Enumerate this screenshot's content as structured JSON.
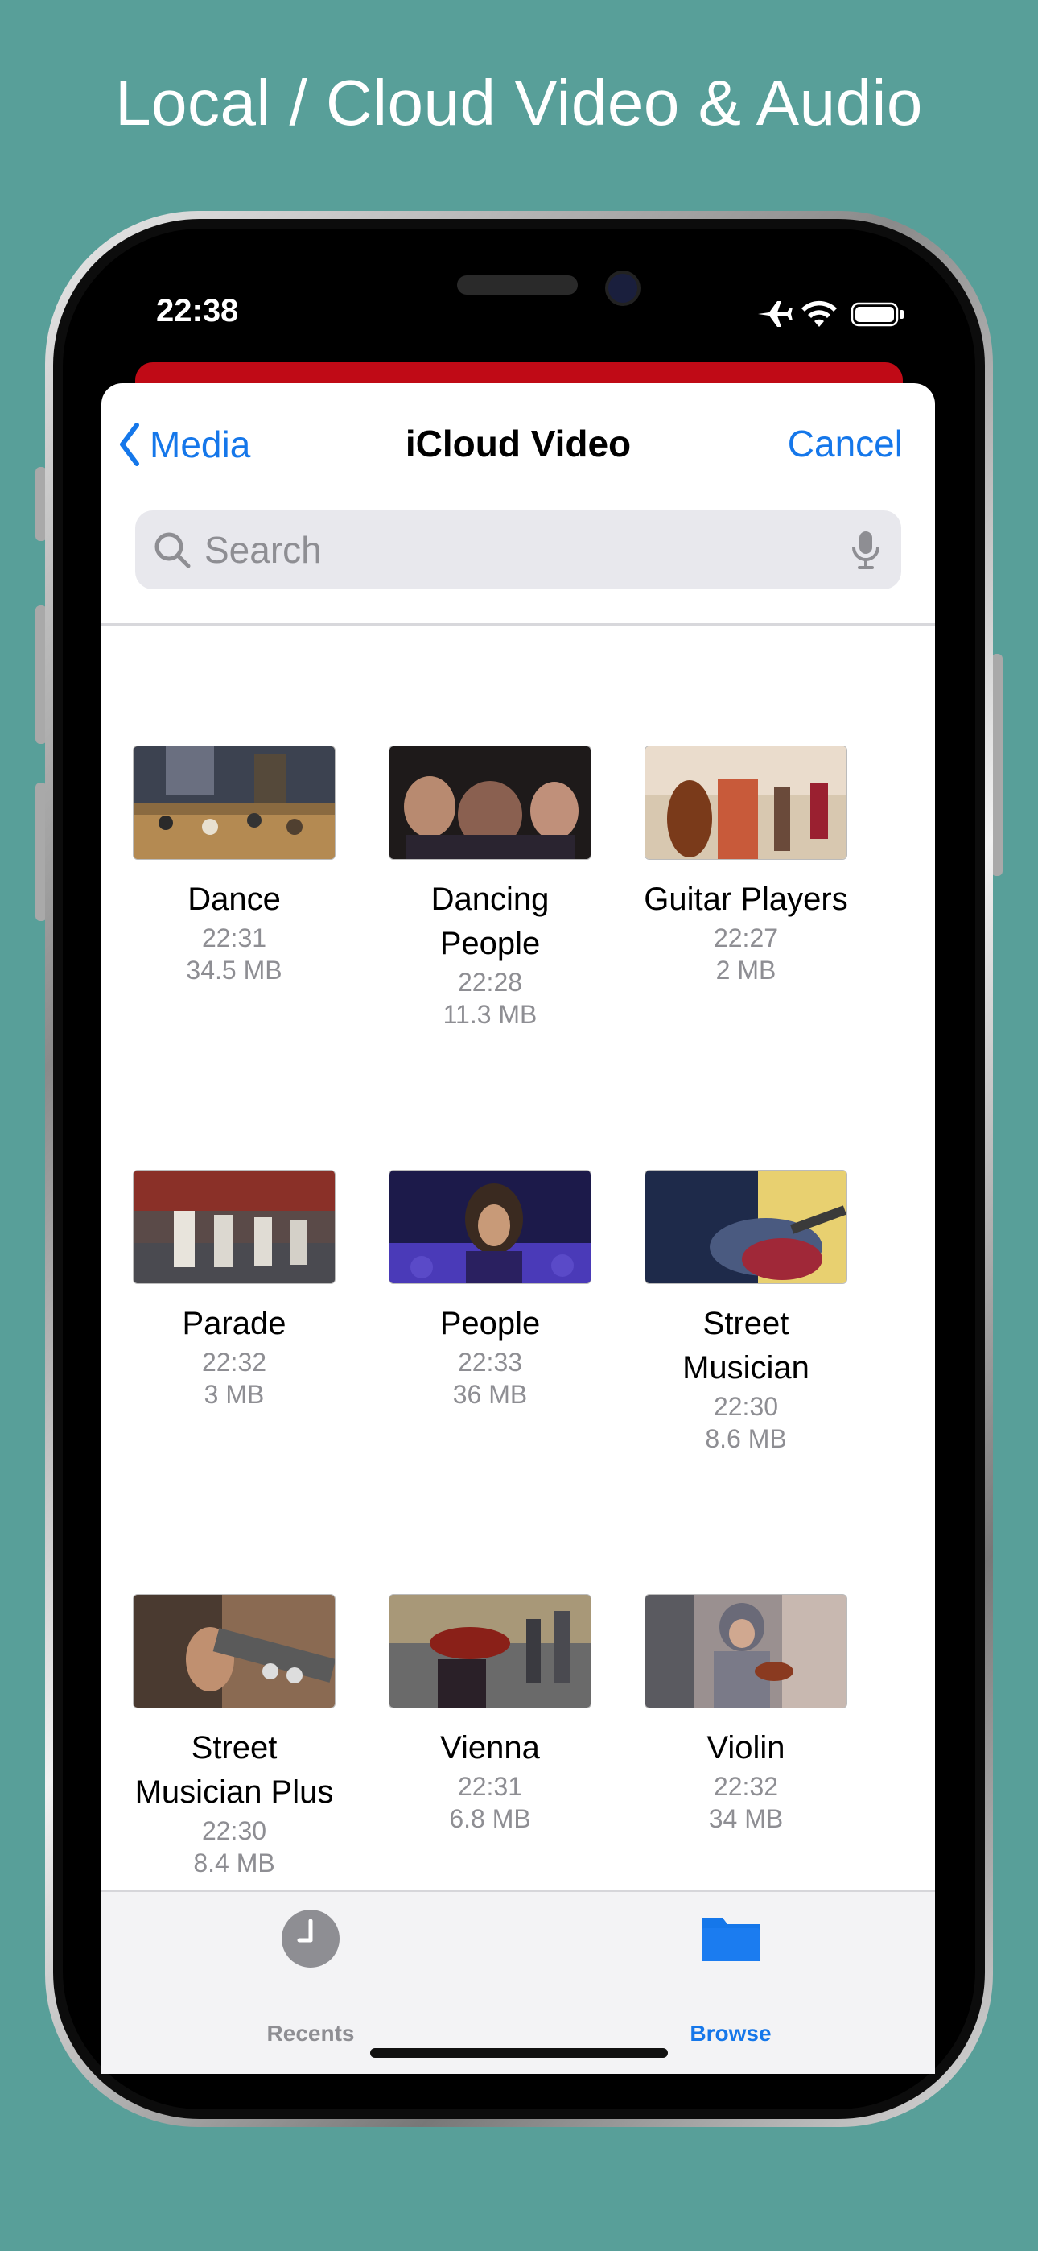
{
  "headline": "Local / Cloud Video & Audio",
  "status_bar": {
    "time": "22:38"
  },
  "nav": {
    "back_label": "Media",
    "title": "iCloud Video",
    "cancel_label": "Cancel"
  },
  "search": {
    "placeholder": "Search"
  },
  "files": [
    {
      "name_line1": "Dance",
      "name_line2": "",
      "time": "22:31",
      "size": "34.5 MB"
    },
    {
      "name_line1": "Dancing",
      "name_line2": "People",
      "time": "22:28",
      "size": "11.3 MB"
    },
    {
      "name_line1": "Guitar Players",
      "name_line2": "",
      "time": "22:27",
      "size": "2 MB"
    },
    {
      "name_line1": "Parade",
      "name_line2": "",
      "time": "22:32",
      "size": "3 MB"
    },
    {
      "name_line1": "People",
      "name_line2": "",
      "time": "22:33",
      "size": "36 MB"
    },
    {
      "name_line1": "Street",
      "name_line2": "Musician",
      "time": "22:30",
      "size": "8.6 MB"
    },
    {
      "name_line1": "Street",
      "name_line2": "Musician Plus",
      "time": "22:30",
      "size": "8.4 MB"
    },
    {
      "name_line1": "Vienna",
      "name_line2": "",
      "time": "22:31",
      "size": "6.8 MB"
    },
    {
      "name_line1": "Violin",
      "name_line2": "",
      "time": "22:32",
      "size": "34 MB"
    }
  ],
  "tabs": [
    {
      "label": "Recents",
      "icon": "clock-icon",
      "active": false
    },
    {
      "label": "Browse",
      "icon": "folder-icon",
      "active": true
    }
  ],
  "colors": {
    "background": "#589f99",
    "accent": "#1577ea",
    "red_strip": "#c00a16"
  }
}
